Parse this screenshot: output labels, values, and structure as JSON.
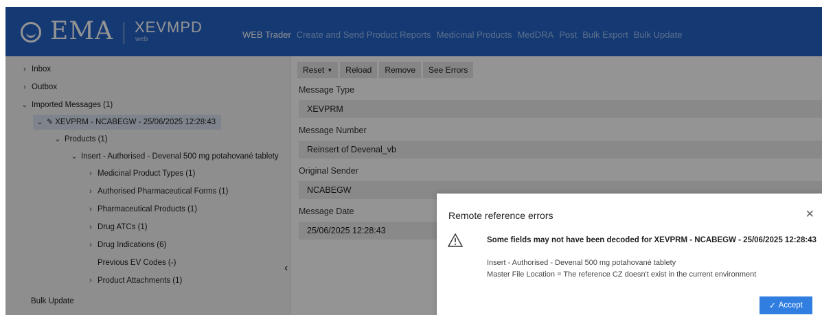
{
  "header": {
    "logo_text": "EMA",
    "app_name": "XEVMPD",
    "app_sub": "web",
    "nav": [
      "WEB Trader",
      "Create and Send Product Reports",
      "Medicinal Products",
      "MedDRA",
      "Post",
      "Bulk Export",
      "Bulk Update"
    ]
  },
  "sidebar": {
    "inbox": "Inbox",
    "outbox": "Outbox",
    "imported": "Imported Messages (1)",
    "message": "XEVPRM - NCABEGW - 25/06/2025 12:28:43",
    "products": "Products (1)",
    "insert": "Insert - Authorised - Devenal 500 mg potahované tablety",
    "children": [
      "Medicinal Product Types (1)",
      "Authorised Pharmaceutical Forms (1)",
      "Pharmaceutical Products (1)",
      "Drug ATCs (1)",
      "Drug Indications (6)",
      "Previous EV Codes (-)",
      "Product Attachments (1)"
    ],
    "bulk_update": "Bulk Update"
  },
  "toolbar": {
    "reset": "Reset",
    "reload": "Reload",
    "remove": "Remove",
    "see_errors": "See Errors"
  },
  "fields": {
    "message_type_label": "Message Type",
    "message_type_value": "XEVPRM",
    "message_number_label": "Message Number",
    "message_number_value": "Reinsert of Devenal_vb",
    "original_sender_label": "Original Sender",
    "original_sender_value": "NCABEGW",
    "message_date_label": "Message Date",
    "message_date_value": "25/06/2025 12:28:43"
  },
  "modal": {
    "title": "Remote reference errors",
    "heading": "Some fields may not have been decoded for XEVPRM - NCABEGW - 25/06/2025 12:28:43",
    "line1": "Insert - Authorised - Devenal 500 mg potahované tablety",
    "line2": "Master File Location = The reference CZ doesn't exist in the current environment",
    "accept": "Accept"
  }
}
